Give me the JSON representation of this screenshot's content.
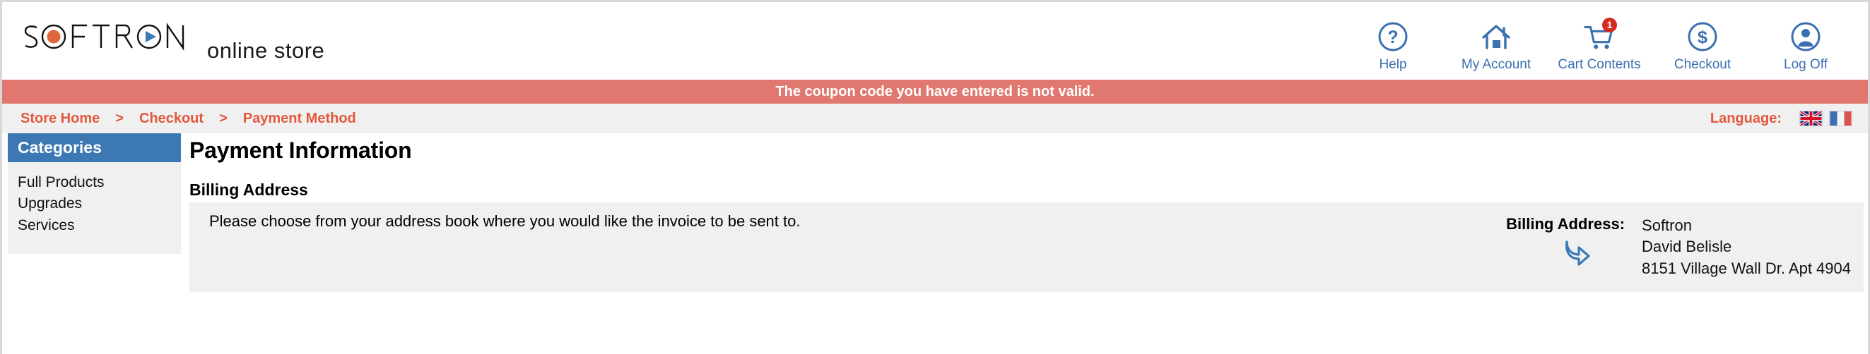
{
  "brand": {
    "wordmark": "SOFTRON",
    "tagline": "online store",
    "dot_color": "#e1663a",
    "play_color": "#3c78b4"
  },
  "header_nav": {
    "accent_color": "#3a6fb0",
    "items": [
      {
        "label": "Help",
        "icon": "question-mark-circle-icon",
        "badge": null
      },
      {
        "label": "My Account",
        "icon": "house-icon",
        "badge": null
      },
      {
        "label": "Cart Contents",
        "icon": "shopping-cart-icon",
        "badge": "1"
      },
      {
        "label": "Checkout",
        "icon": "dollar-sign-circle-icon",
        "badge": null
      },
      {
        "label": "Log Off",
        "icon": "user-avatar-circle-icon",
        "badge": null
      }
    ]
  },
  "alert": {
    "message": "The coupon code you have entered is not valid.",
    "background_color": "#e1786f",
    "text_color": "#ffffff"
  },
  "breadcrumb": {
    "accent_color": "#e2593c",
    "separator": ">",
    "items": [
      {
        "label": "Store Home"
      },
      {
        "label": "Checkout"
      },
      {
        "label": "Payment Method"
      }
    ]
  },
  "language": {
    "label": "Language:",
    "options": [
      {
        "name": "english-flag",
        "title": "English"
      },
      {
        "name": "french-flag",
        "title": "Français"
      }
    ]
  },
  "sidebar": {
    "header": "Categories",
    "header_color": "#3c78b4",
    "items": [
      {
        "label": "Full Products"
      },
      {
        "label": "Upgrades"
      },
      {
        "label": "Services"
      }
    ]
  },
  "main": {
    "page_title": "Payment Information",
    "section_title": "Billing Address",
    "instruction": "Please choose from your address book where you would like the invoice to be sent to.",
    "billing": {
      "label": "Billing Address:",
      "lines": [
        "Softron",
        "David Belisle",
        "8151 Village Wall Dr. Apt 4904"
      ]
    }
  }
}
